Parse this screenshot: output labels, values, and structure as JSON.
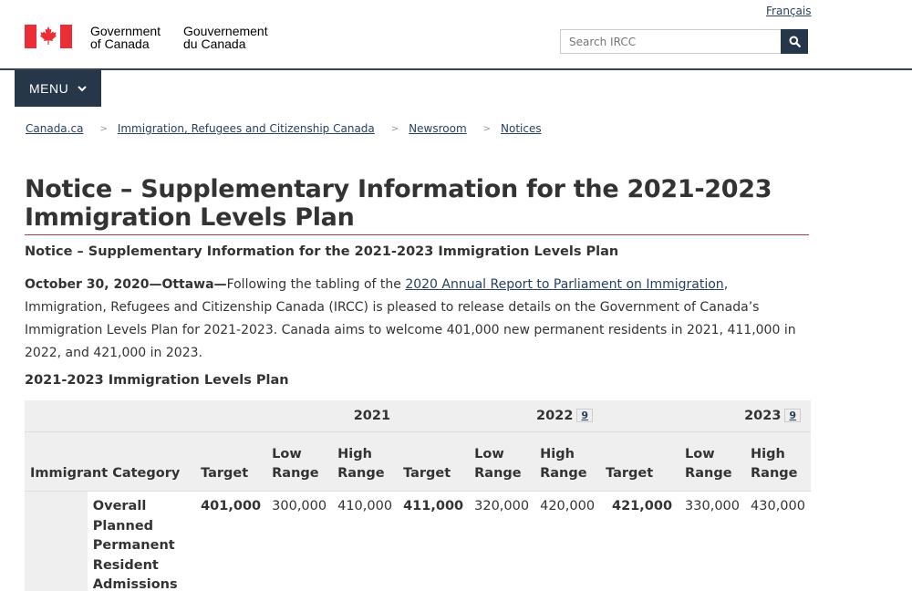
{
  "header": {
    "language_link": "Français",
    "brand_en_line1": "Government",
    "brand_en_line2": "of Canada",
    "brand_fr_line1": "Gouvernement",
    "brand_fr_line2": "du Canada",
    "search_placeholder": "Search IRCC",
    "menu_label": "MENU"
  },
  "colors": {
    "navy": "#26374a",
    "flag_red": "#eb2d37",
    "link": "#284162",
    "rule_red": "#af3c43"
  },
  "breadcrumbs": [
    {
      "label": "Canada.ca"
    },
    {
      "label": "Immigration, Refugees and Citizenship Canada"
    },
    {
      "label": "Newsroom"
    },
    {
      "label": "Notices"
    }
  ],
  "main": {
    "title": "Notice – Supplementary Information for the 2021-2023 Immigration Levels Plan",
    "subheading": "Notice – Supplementary Information for the 2021-2023 Immigration Levels Plan",
    "dateline": "October 30, 2020—Ottawa—",
    "para_before_link": "Following the tabling of the ",
    "para_link": "2020 Annual Report to Parliament on Immigration",
    "para_after_link": ", Immigration, Refugees and Citizenship Canada (IRCC) is pleased to release details on the Government of Canada’s Immigration Levels Plan for 2021-2023. Canada aims to welcome 401,000 new permanent residents in 2021, 411,000 in 2022, and 421,000 in 2023.",
    "table_title": "2021-2023 Immigration Levels Plan"
  },
  "table": {
    "category_header": "Immigrant Category",
    "years": [
      {
        "label": "2021",
        "footnote": ""
      },
      {
        "label": "2022",
        "footnote": "9"
      },
      {
        "label": "2023",
        "footnote": "9"
      }
    ],
    "col_target": "Target",
    "col_low": "Low Range",
    "col_high": "High Range",
    "row": {
      "category": "Overall Planned Permanent Resident Admissions",
      "y2021": {
        "target": "401,000",
        "low": "300,000",
        "high": "410,000"
      },
      "y2022": {
        "target": "411,000",
        "low": "320,000",
        "high": "420,000"
      },
      "y2023": {
        "target": "421,000",
        "low": "330,000",
        "high": "430,000"
      }
    }
  }
}
